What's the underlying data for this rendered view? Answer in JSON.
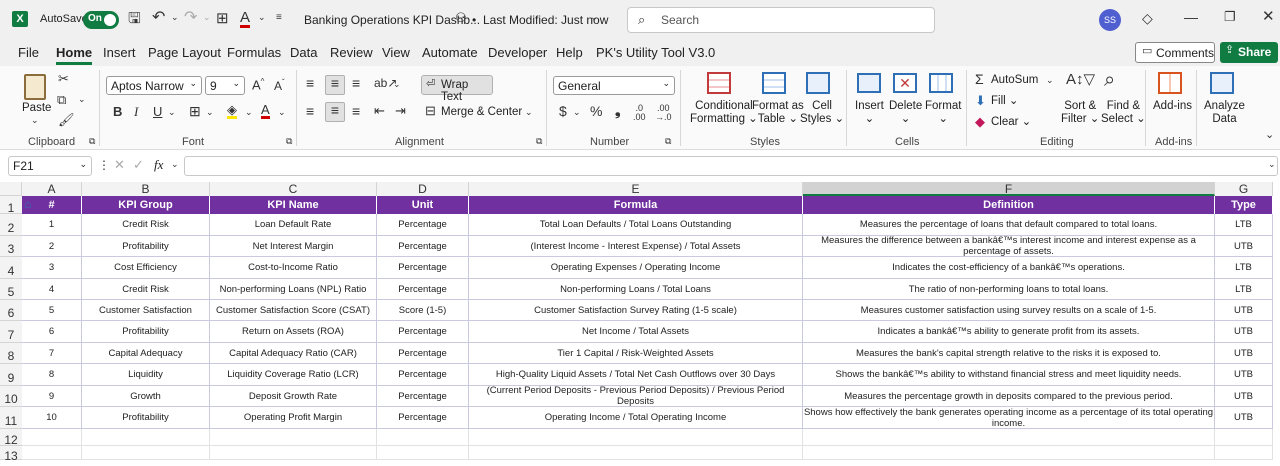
{
  "app": {
    "autosave_label": "AutoSave",
    "autosave_state": "On",
    "file_title": "Banking Operations KPI Dashb...",
    "modified": "Last Modified: Just now",
    "search_placeholder": "Search",
    "user_initials": "SS",
    "accent": "#107c41"
  },
  "menu": {
    "items": [
      "File",
      "Home",
      "Insert",
      "Page Layout",
      "Formulas",
      "Data",
      "Review",
      "View",
      "Automate",
      "Developer",
      "Help",
      "PK's Utility Tool V3.0"
    ],
    "active": "Home",
    "comments": "Comments",
    "share": "Share"
  },
  "ribbon": {
    "paste": "Paste",
    "clipboard": "Clipboard",
    "font_name": "Aptos Narrow",
    "font_size": "9",
    "font_group": "Font",
    "wrap_text": "Wrap Text",
    "merge_center": "Merge & Center",
    "alignment": "Alignment",
    "number_format": "General",
    "number": "Number",
    "cond_fmt_1": "Conditional",
    "cond_fmt_2": "Formatting",
    "fmt_table_1": "Format as",
    "fmt_table_2": "Table",
    "cell_styles_1": "Cell",
    "cell_styles_2": "Styles",
    "styles": "Styles",
    "insert": "Insert",
    "delete": "Delete",
    "format": "Format",
    "cells": "Cells",
    "autosum": "AutoSum",
    "fill": "Fill",
    "clear": "Clear",
    "sort_1": "Sort &",
    "sort_2": "Filter",
    "find_1": "Find &",
    "find_2": "Select",
    "editing": "Editing",
    "addins": "Add-ins",
    "addins_group": "Add-ins",
    "analyze_1": "Analyze",
    "analyze_2": "Data"
  },
  "formula_bar": {
    "name_box": "F21",
    "fx": "fx",
    "value": ""
  },
  "sheet": {
    "columns": [
      "A",
      "B",
      "C",
      "D",
      "E",
      "F",
      "G"
    ],
    "headers": [
      "#",
      "KPI Group",
      "KPI Name",
      "Unit",
      "Formula",
      "Definition",
      "Type"
    ],
    "row_numbers": [
      "1",
      "2",
      "3",
      "4",
      "5",
      "6",
      "7",
      "8",
      "9",
      "10",
      "11",
      "12",
      "13"
    ],
    "header_color": "#7030a0",
    "rows": [
      [
        "1",
        "Credit Risk",
        "Loan Default Rate",
        "Percentage",
        "Total Loan Defaults / Total Loans Outstanding",
        "Measures the percentage of loans that default compared to total loans.",
        "LTB"
      ],
      [
        "2",
        "Profitability",
        "Net Interest Margin",
        "Percentage",
        "(Interest Income - Interest Expense) / Total Assets",
        "Measures the difference between a bankâ€™s interest income and interest expense as a percentage of assets.",
        "UTB"
      ],
      [
        "3",
        "Cost Efficiency",
        "Cost-to-Income Ratio",
        "Percentage",
        "Operating Expenses / Operating Income",
        "Indicates the cost-efficiency of a bankâ€™s operations.",
        "LTB"
      ],
      [
        "4",
        "Credit Risk",
        "Non-performing Loans (NPL) Ratio",
        "Percentage",
        "Non-performing Loans / Total Loans",
        "The ratio of non-performing loans to total loans.",
        "LTB"
      ],
      [
        "5",
        "Customer Satisfaction",
        "Customer Satisfaction Score (CSAT)",
        "Score (1-5)",
        "Customer Satisfaction Survey Rating (1-5 scale)",
        "Measures customer satisfaction using survey results on a scale of 1-5.",
        "UTB"
      ],
      [
        "6",
        "Profitability",
        "Return on Assets (ROA)",
        "Percentage",
        "Net Income / Total Assets",
        "Indicates a bankâ€™s ability to generate profit from its assets.",
        "UTB"
      ],
      [
        "7",
        "Capital Adequacy",
        "Capital Adequacy Ratio (CAR)",
        "Percentage",
        "Tier 1 Capital / Risk-Weighted Assets",
        "Measures the bank's capital strength relative to the risks it is exposed to.",
        "UTB"
      ],
      [
        "8",
        "Liquidity",
        "Liquidity Coverage Ratio (LCR)",
        "Percentage",
        "High-Quality Liquid Assets / Total Net Cash Outflows over 30 Days",
        "Shows the bankâ€™s ability to withstand financial stress and meet liquidity needs.",
        "UTB"
      ],
      [
        "9",
        "Growth",
        "Deposit Growth Rate",
        "Percentage",
        "(Current Period Deposits - Previous Period Deposits) / Previous Period Deposits",
        "Measures the percentage growth in deposits compared to the previous period.",
        "UTB"
      ],
      [
        "10",
        "Profitability",
        "Operating Profit Margin",
        "Percentage",
        "Operating Income / Total Operating Income",
        "Shows how effectively the bank generates operating income as a percentage of its total operating income.",
        "UTB"
      ]
    ]
  }
}
